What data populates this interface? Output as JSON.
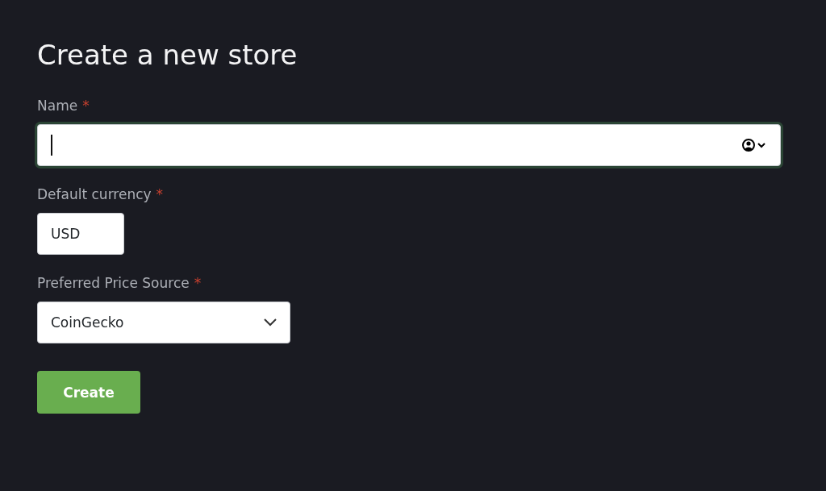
{
  "title": "Create a new store",
  "fields": [
    {
      "kind": "text",
      "label": "Name",
      "required_mark": "*",
      "focused": true
    },
    {
      "kind": "short",
      "label": "Default currency",
      "required_mark": "*",
      "value": "USD",
      "focused": false
    },
    {
      "kind": "select",
      "label": "Preferred Price Source",
      "required_mark": "*",
      "value": "CoinGecko",
      "focused": false
    }
  ],
  "submit": {
    "label": "Create"
  }
}
